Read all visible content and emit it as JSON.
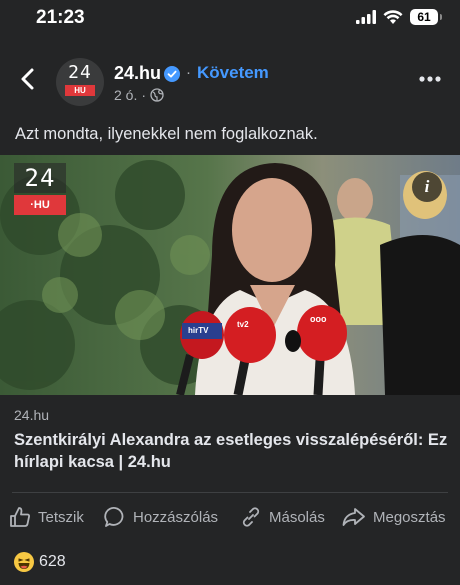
{
  "status_bar": {
    "time": "21:23",
    "battery": "61"
  },
  "post": {
    "page_name": "24.hu",
    "follow_label": "Követem",
    "separator": "·",
    "time_ago": "2 ó.",
    "meta_sep": "·",
    "avatar_number": "24",
    "avatar_tag": "HU",
    "text": "Azt mondta, ilyenekkel nem foglalkoznak."
  },
  "media": {
    "logo_number": "24",
    "logo_tag": "·HU",
    "info_label": "i",
    "mic_labels": [
      "hirTV",
      "tv2",
      "ooo"
    ]
  },
  "link": {
    "domain": "24.hu",
    "title": "Szentkirályi Alexandra az esetleges visszalépéséről: Ez hírlapi kacsa | 24.hu"
  },
  "actions": {
    "like": "Tetszik",
    "comment": "Hozzászólás",
    "copy": "Másolás",
    "share": "Megosztás"
  },
  "reactions": {
    "count": "628"
  },
  "colors": {
    "accent": "#4599ff",
    "background": "#242526",
    "brand_red": "#e0383b"
  }
}
